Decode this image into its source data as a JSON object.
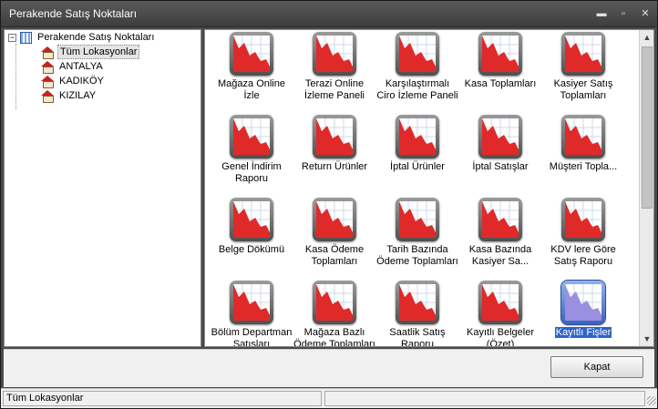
{
  "window": {
    "title": "Perakende Satış Noktaları",
    "controls": {
      "minimize": "▬",
      "maximize": "▫",
      "close": "✕"
    }
  },
  "tree": {
    "root": {
      "label": "Perakende Satış Noktaları",
      "expander": "−",
      "icon": "grid-icon"
    },
    "items": [
      {
        "label": "Tüm Lokasyonlar",
        "icon": "store-icon",
        "selected": true
      },
      {
        "label": "ANTALYA",
        "icon": "store-icon"
      },
      {
        "label": "KADIKÖY",
        "icon": "store-icon"
      },
      {
        "label": "KIZILAY",
        "icon": "store-icon"
      }
    ]
  },
  "reports": [
    {
      "label": "Mağaza Online İzle",
      "icon": "report-chart-icon"
    },
    {
      "label": "Terazi Online İzleme Paneli",
      "icon": "report-chart-icon"
    },
    {
      "label": "Karşılaştırmalı Ciro İzleme Paneli",
      "icon": "report-chart-icon"
    },
    {
      "label": "Kasa Toplamları",
      "icon": "report-chart-icon"
    },
    {
      "label": "Kasiyer Satış Toplamları",
      "icon": "report-chart-icon"
    },
    {
      "label": "Genel İndirim Raporu",
      "icon": "report-chart-icon"
    },
    {
      "label": "Return Ürünler",
      "icon": "report-chart-icon"
    },
    {
      "label": "İptal Ürünler",
      "icon": "report-chart-icon"
    },
    {
      "label": "İptal Satışlar",
      "icon": "report-chart-icon"
    },
    {
      "label": "Müşteri Topla...",
      "icon": "report-chart-icon"
    },
    {
      "label": "Belge Dökümü",
      "icon": "report-chart-icon"
    },
    {
      "label": "Kasa Ödeme Toplamları",
      "icon": "report-chart-icon"
    },
    {
      "label": "Tarih Bazında Ödeme Toplamları",
      "icon": "report-chart-icon"
    },
    {
      "label": "Kasa Bazında Kasiyer Sa...",
      "icon": "report-chart-icon"
    },
    {
      "label": "KDV lere Göre Satış Raporu",
      "icon": "report-chart-icon"
    },
    {
      "label": "Bölüm Departman Satışları",
      "icon": "report-chart-icon"
    },
    {
      "label": "Mağaza Bazlı Ödeme Toplamları",
      "icon": "report-chart-icon"
    },
    {
      "label": "Saatlik Satış Raporu",
      "icon": "report-chart-icon"
    },
    {
      "label": "Kayıtlı Belgeler (Özet)",
      "icon": "report-chart-icon"
    },
    {
      "label": "Kayıtlı Fişler",
      "icon": "report-chart-icon",
      "selected": true
    }
  ],
  "scrollbar": {
    "up": "▲",
    "down": "▼"
  },
  "footer": {
    "close_button": "Kapat"
  },
  "status": {
    "location": "Tüm Lokasyonlar",
    "secondary": ""
  },
  "colors": {
    "chart_red": "#e02a2a",
    "selected_blue": "#2f64c8",
    "title_bg": "#4a4a4a"
  }
}
